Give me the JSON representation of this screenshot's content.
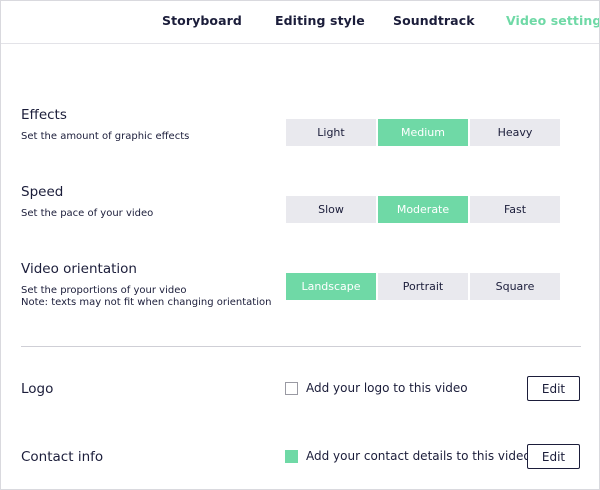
{
  "colors": {
    "accent": "#6fd9a6",
    "text": "#1b1d3a",
    "segment_bg": "#e9e9ee"
  },
  "tabs": [
    {
      "label": "Storyboard",
      "active": false
    },
    {
      "label": "Editing style",
      "active": false
    },
    {
      "label": "Soundtrack",
      "active": false
    },
    {
      "label": "Video settings",
      "active": true
    }
  ],
  "effects": {
    "title": "Effects",
    "description": "Set the amount of graphic effects",
    "options": [
      "Light",
      "Medium",
      "Heavy"
    ],
    "selected": "Medium"
  },
  "speed": {
    "title": "Speed",
    "description": "Set the pace of your video",
    "options": [
      "Slow",
      "Moderate",
      "Fast"
    ],
    "selected": "Moderate"
  },
  "orientation": {
    "title": "Video orientation",
    "description": "Set the proportions of your video",
    "note": "Note: texts may not fit when changing orientation",
    "options": [
      "Landscape",
      "Portrait",
      "Square"
    ],
    "selected": "Landscape"
  },
  "logo": {
    "label": "Logo",
    "checkbox_label": "Add your logo to this video",
    "checked": false,
    "edit_label": "Edit"
  },
  "contact": {
    "label": "Contact info",
    "checkbox_label": "Add your contact details to this video",
    "checked": true,
    "edit_label": "Edit"
  }
}
